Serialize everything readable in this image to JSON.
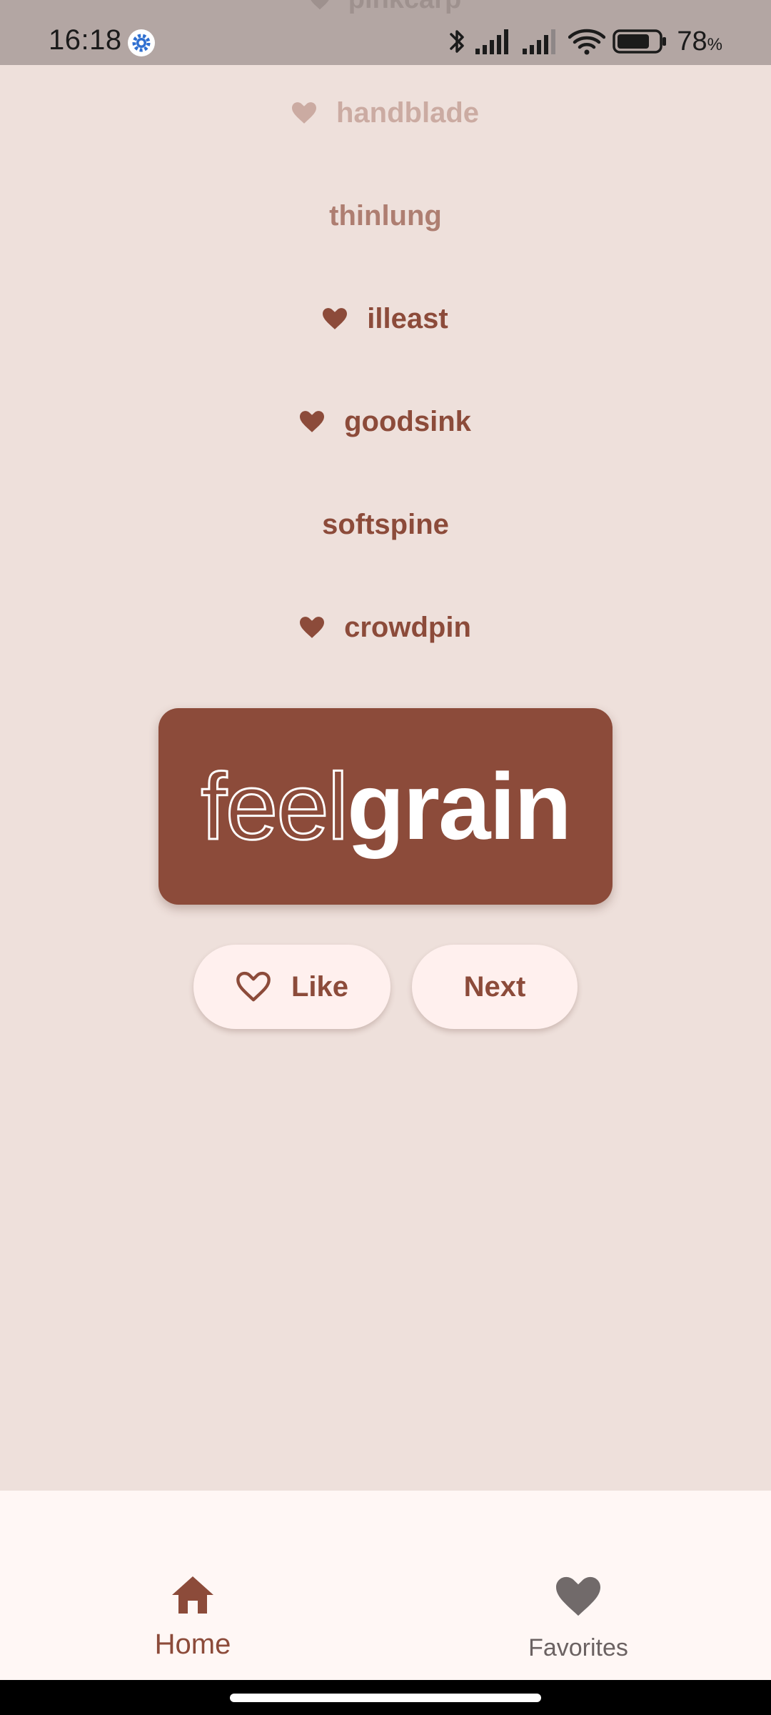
{
  "status_bar": {
    "time": "16:18",
    "battery_percent": "78",
    "battery_percent_sign": "%",
    "icons": [
      "settings-gear-icon",
      "bluetooth-icon",
      "signal-icon",
      "signal-icon",
      "wifi-icon",
      "battery-icon"
    ],
    "battery_level": 0.78
  },
  "word_list": {
    "ghost_item": "pinkcarp",
    "items": [
      {
        "word": "handblade",
        "liked": true,
        "opacity": 0.35
      },
      {
        "word": "thinlung",
        "liked": false,
        "opacity": 0.65
      },
      {
        "word": "illeast",
        "liked": true,
        "opacity": 1
      },
      {
        "word": "goodsink",
        "liked": true,
        "opacity": 1
      },
      {
        "word": "softspine",
        "liked": false,
        "opacity": 1
      },
      {
        "word": "crowdpin",
        "liked": true,
        "opacity": 1
      }
    ]
  },
  "current_pair": {
    "first": "feel",
    "second": "grain"
  },
  "actions": {
    "like_label": "Like",
    "next_label": "Next"
  },
  "bottom_nav": {
    "home_label": "Home",
    "favorites_label": "Favorites",
    "selected": "home"
  },
  "colors": {
    "background": "#EEE0DB",
    "accent": "#8C4B3A",
    "button_bg": "#FFF0EE",
    "status_bar": "#B3A6A3",
    "nav_bg": "#FFF7F5",
    "inactive": "#6B6262"
  }
}
